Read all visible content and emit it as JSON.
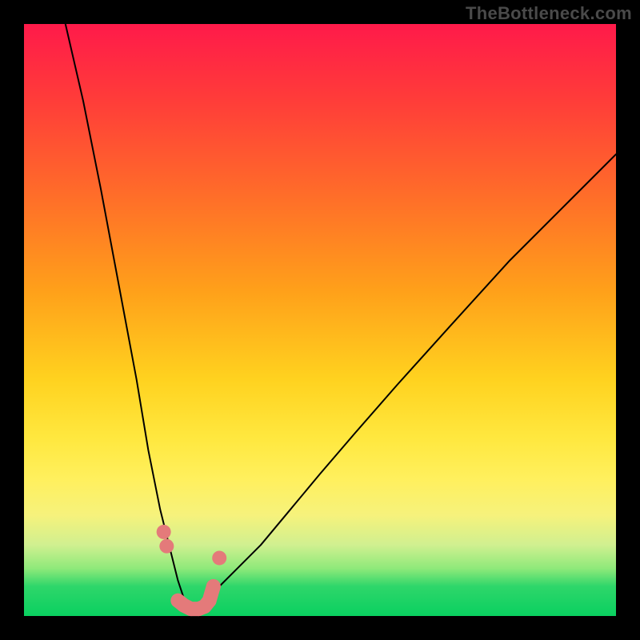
{
  "watermark": "TheBottleneck.com",
  "chart_data": {
    "type": "line",
    "title": "",
    "xlabel": "",
    "ylabel": "",
    "xlim": [
      0,
      100
    ],
    "ylim": [
      0,
      100
    ],
    "background_gradient": {
      "top_color": "#ff1a4a",
      "bottom_color": "#0ad060"
    },
    "black_curve": {
      "description": "Asymmetric V-shaped bottleneck curve; minimum near x≈28, rises steeply left and gently right",
      "stroke": "#000000",
      "x": [
        7,
        10,
        13,
        16,
        19,
        21,
        23,
        25,
        26,
        27,
        28,
        29,
        30,
        31,
        33,
        36,
        40,
        45,
        50,
        56,
        63,
        72,
        82,
        92,
        100
      ],
      "y": [
        100,
        87,
        72,
        56,
        40,
        28,
        18,
        10,
        6,
        3,
        1,
        1,
        2,
        3,
        5,
        8,
        12,
        18,
        24,
        31,
        39,
        49,
        60,
        70,
        78
      ]
    },
    "pink_points": {
      "description": "Cluster of points near the curve minimum",
      "stroke": "#e47a7a",
      "fill": "#e47a7a",
      "x": [
        23.6,
        24.1,
        26.0,
        27.0,
        28.2,
        29.5,
        30.5,
        31.3,
        32.0,
        33.0
      ],
      "y": [
        14.2,
        11.8,
        2.6,
        1.8,
        1.2,
        1.2,
        1.6,
        2.6,
        5.0,
        9.8
      ]
    }
  },
  "styles": {
    "black_stroke_width": 2,
    "pink_point_radius": 9
  }
}
